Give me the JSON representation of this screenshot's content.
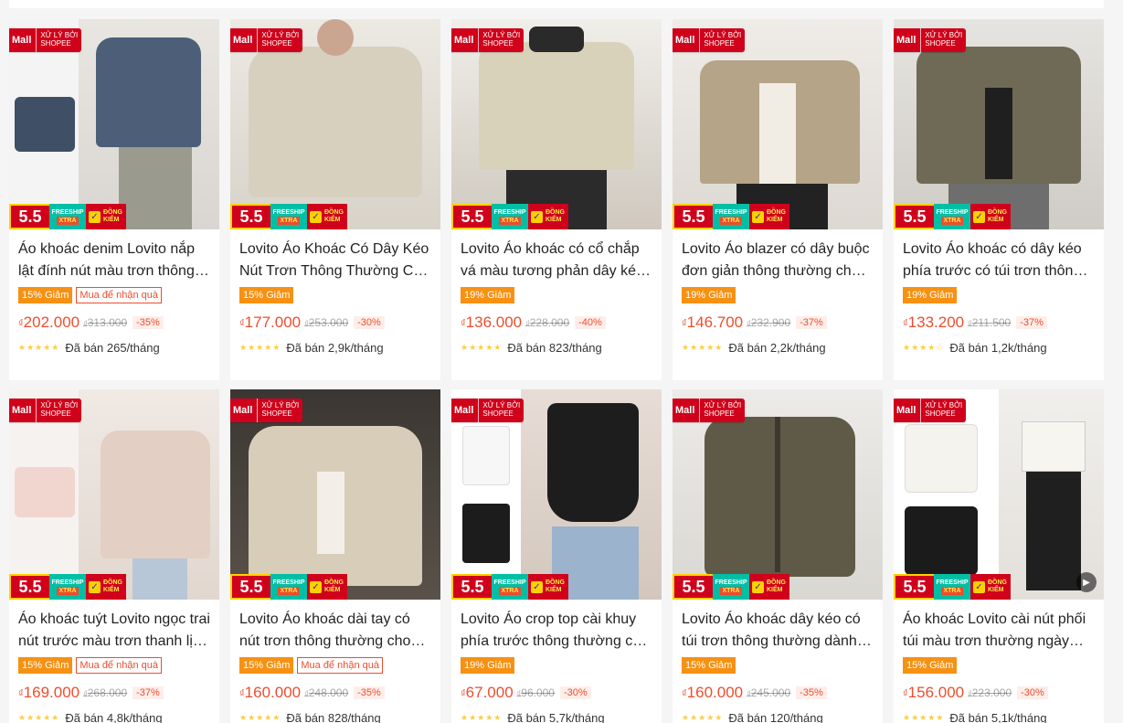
{
  "badges": {
    "mall": "Mall",
    "mall_sub_1": "XỬ LÝ BỞI",
    "mall_sub_2": "SHOPEE",
    "sale": "5.5",
    "freeship_1": "FREESHIP",
    "freeship_2": "XTRA",
    "dongkiem_1": "ĐỒNG",
    "dongkiem_2": "KIỂM",
    "currency": "₫"
  },
  "colors": {
    "accent": "#ee4d2d",
    "discount_tag": "#f69113",
    "mall_red": "#d0011b",
    "star": "#ffce3d"
  },
  "products": [
    {
      "title": "Áo khoác denim Lovito nắp lật đính nút màu trơn thông thường cho nữ",
      "discount": "15% Giảm",
      "gift": "Mua để nhận quà",
      "price": "202.000",
      "old_price": "313.000",
      "pct": "-35%",
      "stars": "★★★★★",
      "sold": "Đã bán 265/tháng"
    },
    {
      "title": "Lovito Áo Khoác Có Dây Kéo Nút Trơn Thông Thường Cho Nữ",
      "discount": "15% Giảm",
      "gift": "",
      "price": "177.000",
      "old_price": "253.000",
      "pct": "-30%",
      "stars": "★★★★★",
      "sold": "Đã bán 2,9k/tháng"
    },
    {
      "title": "Lovito Áo khoác có cổ chắp vá màu tương phản dây kéo cho nữ",
      "discount": "19% Giảm",
      "gift": "",
      "price": "136.000",
      "old_price": "228.000",
      "pct": "-40%",
      "stars": "★★★★★",
      "sold": "Đã bán 823/tháng"
    },
    {
      "title": "Lovito Áo blazer có dây buộc đơn giản thông thường cho nữ",
      "discount": "19% Giảm",
      "gift": "",
      "price": "146.700",
      "old_price": "232.900",
      "pct": "-37%",
      "stars": "★★★★★",
      "sold": "Đã bán 2,2k/tháng"
    },
    {
      "title": "Lovito Áo khoác có dây kéo phía trước có túi trơn thông thường cho nữ",
      "discount": "19% Giảm",
      "gift": "",
      "price": "133.200",
      "old_price": "211.500",
      "pct": "-37%",
      "stars": "★★★★☆",
      "sold": "Đã bán 1,2k/tháng"
    },
    {
      "title": "Áo khoác tuýt Lovito ngọc trai nút trước màu trơn thanh lịch cho nữ",
      "discount": "15% Giảm",
      "gift": "Mua để nhận quà",
      "price": "169.000",
      "old_price": "268.000",
      "pct": "-37%",
      "stars": "★★★★★",
      "sold": "Đã bán 4,8k/tháng"
    },
    {
      "title": "Lovito Áo khoác dài tay có nút trơn thông thường cho nữ",
      "discount": "15% Giảm",
      "gift": "Mua để nhận quà",
      "price": "160.000",
      "old_price": "248.000",
      "pct": "-35%",
      "stars": "★★★★★",
      "sold": "Đã bán 828/tháng"
    },
    {
      "title": "Lovito Áo crop top cài khuy phía trước thông thường cho nữ",
      "discount": "19% Giảm",
      "gift": "",
      "price": "67.000",
      "old_price": "96.000",
      "pct": "-30%",
      "stars": "★★★★★",
      "sold": "Đã bán 5,7k/tháng"
    },
    {
      "title": "Lovito Áo khoác dây kéo có túi trơn thông thường dành cho nữ",
      "discount": "15% Giảm",
      "gift": "",
      "price": "160.000",
      "old_price": "245.000",
      "pct": "-35%",
      "stars": "★★★★★",
      "sold": "Đã bán 120/tháng"
    },
    {
      "title": "Áo khoác Lovito cài nút phối túi màu trơn thường ngày cho nữ",
      "discount": "15% Giảm",
      "gift": "",
      "price": "156.000",
      "old_price": "223.000",
      "pct": "-30%",
      "stars": "★★★★★",
      "sold": "Đã bán 5,1k/tháng"
    }
  ]
}
